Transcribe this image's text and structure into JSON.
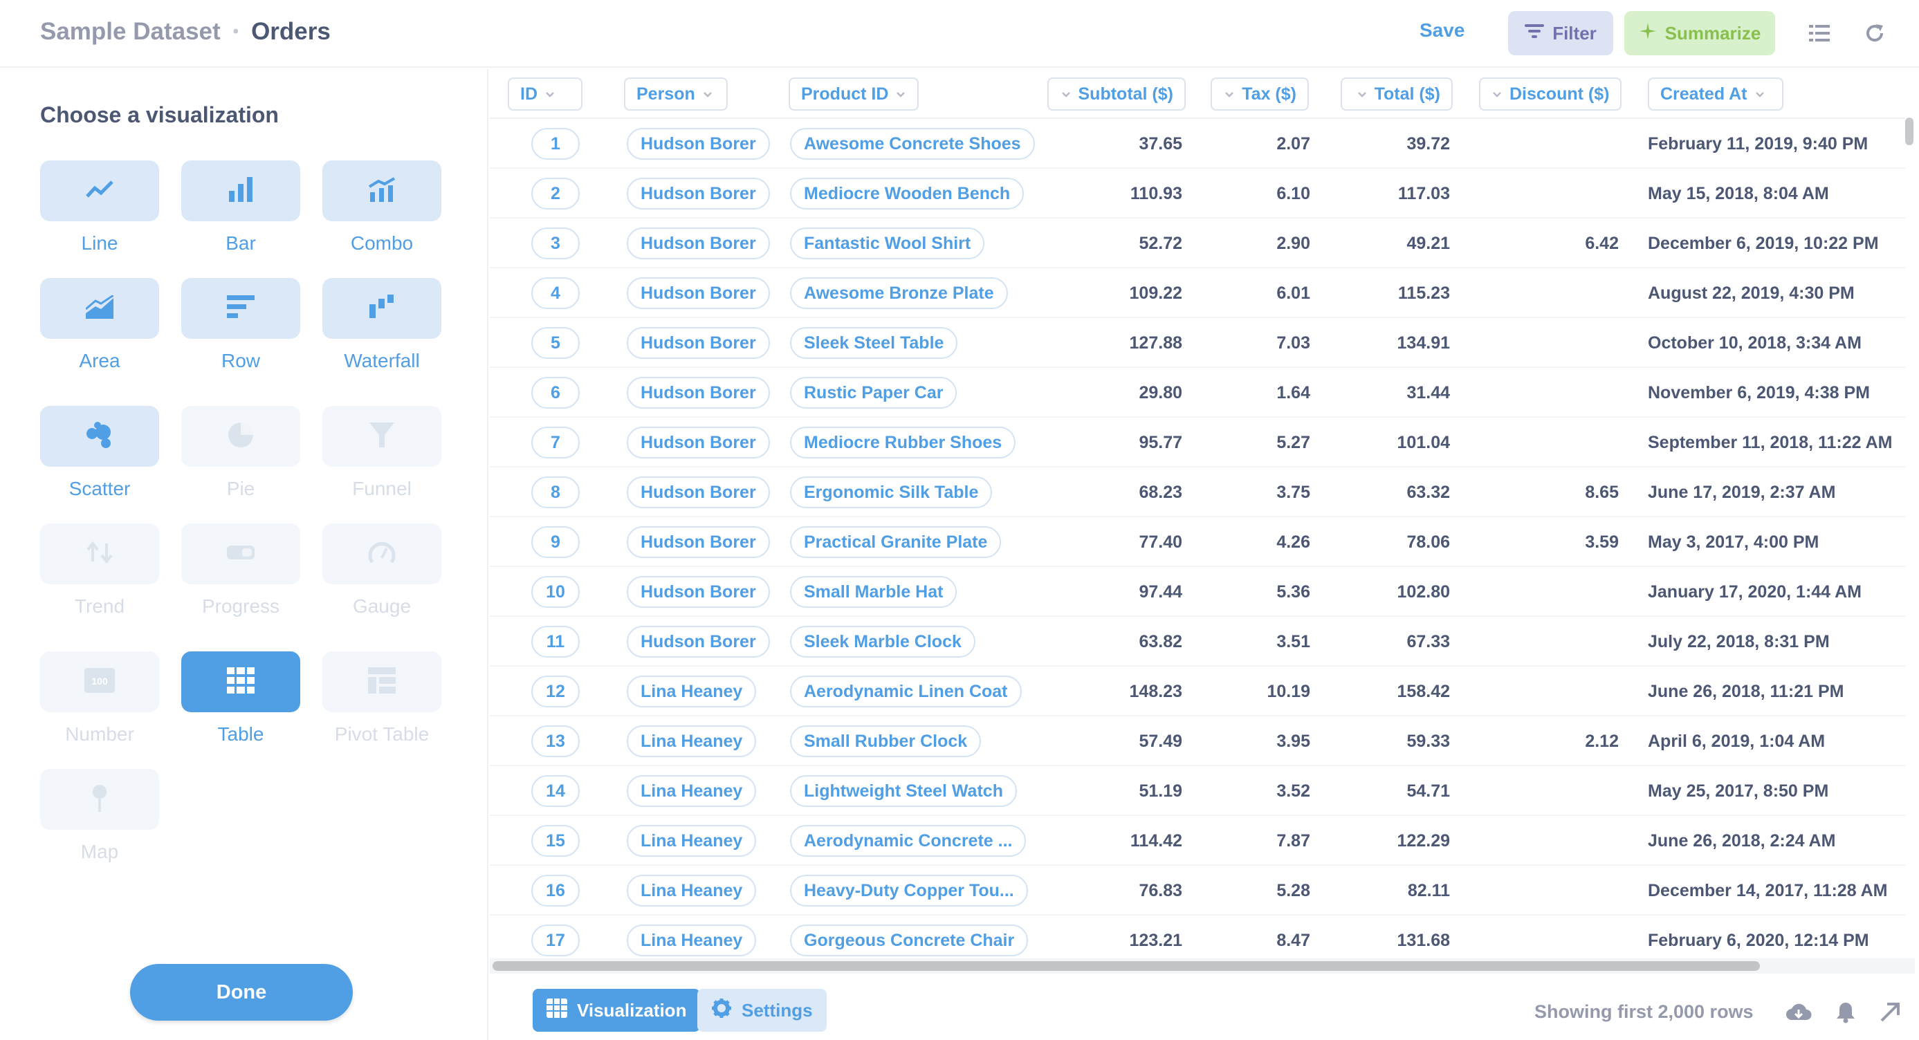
{
  "header": {
    "dataset": "Sample Dataset",
    "separator": "•",
    "table": "Orders",
    "save_label": "Save",
    "filter_label": "Filter",
    "summarize_label": "Summarize",
    "colors": {
      "accent": "#509ee3",
      "filter": "#7172ad",
      "summarize": "#88bf4d"
    }
  },
  "sidebar": {
    "title": "Choose a visualization",
    "options": [
      {
        "label": "Line",
        "icon": "line-chart-icon",
        "state": "enabled"
      },
      {
        "label": "Bar",
        "icon": "bar-chart-icon",
        "state": "enabled"
      },
      {
        "label": "Combo",
        "icon": "combo-chart-icon",
        "state": "enabled"
      },
      {
        "label": "Area",
        "icon": "area-chart-icon",
        "state": "enabled"
      },
      {
        "label": "Row",
        "icon": "row-chart-icon",
        "state": "enabled"
      },
      {
        "label": "Waterfall",
        "icon": "waterfall-chart-icon",
        "state": "enabled"
      },
      {
        "label": "Scatter",
        "icon": "scatter-chart-icon",
        "state": "enabled"
      },
      {
        "label": "Pie",
        "icon": "pie-chart-icon",
        "state": "disabled"
      },
      {
        "label": "Funnel",
        "icon": "funnel-icon",
        "state": "disabled"
      },
      {
        "label": "Trend",
        "icon": "trend-icon",
        "state": "disabled"
      },
      {
        "label": "Progress",
        "icon": "progress-icon",
        "state": "disabled"
      },
      {
        "label": "Gauge",
        "icon": "gauge-icon",
        "state": "disabled"
      },
      {
        "label": "Number",
        "icon": "number-icon",
        "state": "disabled"
      },
      {
        "label": "Table",
        "icon": "table-icon",
        "state": "selected"
      },
      {
        "label": "Pivot Table",
        "icon": "pivot-table-icon",
        "state": "disabled"
      },
      {
        "label": "Map",
        "icon": "map-pin-icon",
        "state": "disabled"
      }
    ],
    "number_icon_text": "100",
    "done_label": "Done"
  },
  "table": {
    "columns": [
      "ID",
      "Person",
      "Product ID",
      "Subtotal ($)",
      "Tax ($)",
      "Total ($)",
      "Discount ($)",
      "Created At"
    ],
    "rows": [
      [
        "1",
        "Hudson Borer",
        "Awesome Concrete Shoes",
        "37.65",
        "2.07",
        "39.72",
        "",
        "February 11, 2019, 9:40 PM"
      ],
      [
        "2",
        "Hudson Borer",
        "Mediocre Wooden Bench",
        "110.93",
        "6.10",
        "117.03",
        "",
        "May 15, 2018, 8:04 AM"
      ],
      [
        "3",
        "Hudson Borer",
        "Fantastic Wool Shirt",
        "52.72",
        "2.90",
        "49.21",
        "6.42",
        "December 6, 2019, 10:22 PM"
      ],
      [
        "4",
        "Hudson Borer",
        "Awesome Bronze Plate",
        "109.22",
        "6.01",
        "115.23",
        "",
        "August 22, 2019, 4:30 PM"
      ],
      [
        "5",
        "Hudson Borer",
        "Sleek Steel Table",
        "127.88",
        "7.03",
        "134.91",
        "",
        "October 10, 2018, 3:34 AM"
      ],
      [
        "6",
        "Hudson Borer",
        "Rustic Paper Car",
        "29.80",
        "1.64",
        "31.44",
        "",
        "November 6, 2019, 4:38 PM"
      ],
      [
        "7",
        "Hudson Borer",
        "Mediocre Rubber Shoes",
        "95.77",
        "5.27",
        "101.04",
        "",
        "September 11, 2018, 11:22 AM"
      ],
      [
        "8",
        "Hudson Borer",
        "Ergonomic Silk Table",
        "68.23",
        "3.75",
        "63.32",
        "8.65",
        "June 17, 2019, 2:37 AM"
      ],
      [
        "9",
        "Hudson Borer",
        "Practical Granite Plate",
        "77.40",
        "4.26",
        "78.06",
        "3.59",
        "May 3, 2017, 4:00 PM"
      ],
      [
        "10",
        "Hudson Borer",
        "Small Marble Hat",
        "97.44",
        "5.36",
        "102.80",
        "",
        "January 17, 2020, 1:44 AM"
      ],
      [
        "11",
        "Hudson Borer",
        "Sleek Marble Clock",
        "63.82",
        "3.51",
        "67.33",
        "",
        "July 22, 2018, 8:31 PM"
      ],
      [
        "12",
        "Lina Heaney",
        "Aerodynamic Linen Coat",
        "148.23",
        "10.19",
        "158.42",
        "",
        "June 26, 2018, 11:21 PM"
      ],
      [
        "13",
        "Lina Heaney",
        "Small Rubber Clock",
        "57.49",
        "3.95",
        "59.33",
        "2.12",
        "April 6, 2019, 1:04 AM"
      ],
      [
        "14",
        "Lina Heaney",
        "Lightweight Steel Watch",
        "51.19",
        "3.52",
        "54.71",
        "",
        "May 25, 2017, 8:50 PM"
      ],
      [
        "15",
        "Lina Heaney",
        "Aerodynamic Concrete ...",
        "114.42",
        "7.87",
        "122.29",
        "",
        "June 26, 2018, 2:24 AM"
      ],
      [
        "16",
        "Lina Heaney",
        "Heavy-Duty Copper Tou...",
        "76.83",
        "5.28",
        "82.11",
        "",
        "December 14, 2017, 11:28 AM"
      ],
      [
        "17",
        "Lina Heaney",
        "Gorgeous Concrete Chair",
        "123.21",
        "8.47",
        "131.68",
        "",
        "February 6, 2020, 12:14 PM"
      ]
    ]
  },
  "footer": {
    "visualization_label": "Visualization",
    "settings_label": "Settings",
    "row_count": "Showing first 2,000 rows"
  }
}
